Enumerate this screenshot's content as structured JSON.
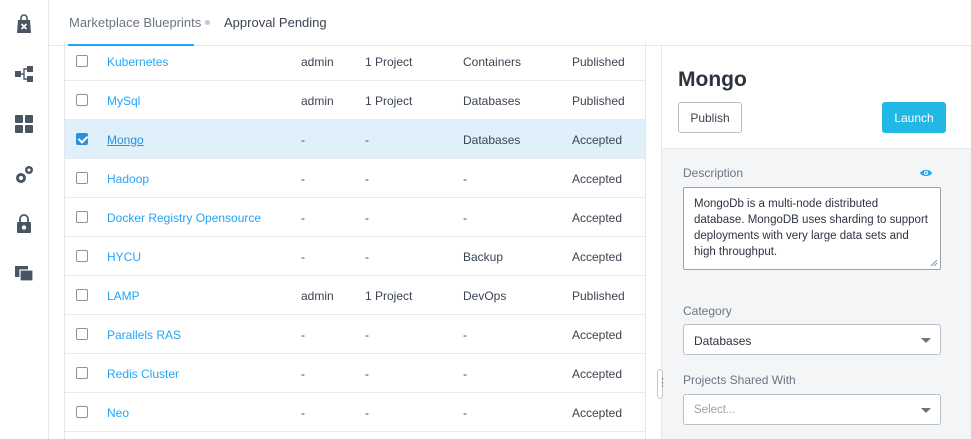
{
  "header": {
    "breadcrumb_1": "Marketplace Blueprints",
    "breadcrumb_2": "Approval Pending"
  },
  "rail": {
    "items": [
      "bag-x-icon",
      "nodes-icon",
      "apps-grid-icon",
      "gears-icon",
      "lock-gear-icon",
      "folders-icon"
    ]
  },
  "table": {
    "rows": [
      {
        "name": "Kubernetes",
        "owner": "admin",
        "projects": "1 Project",
        "category": "Containers",
        "status": "Published",
        "checked": false
      },
      {
        "name": "MySql",
        "owner": "admin",
        "projects": "1 Project",
        "category": "Databases",
        "status": "Published",
        "checked": false
      },
      {
        "name": "Mongo",
        "owner": "-",
        "projects": "-",
        "category": "Databases",
        "status": "Accepted",
        "checked": true
      },
      {
        "name": "Hadoop",
        "owner": "-",
        "projects": "-",
        "category": "-",
        "status": "Accepted",
        "checked": false
      },
      {
        "name": "Docker Registry Opensource",
        "owner": "-",
        "projects": "-",
        "category": "-",
        "status": "Accepted",
        "checked": false
      },
      {
        "name": "HYCU",
        "owner": "-",
        "projects": "-",
        "category": "Backup",
        "status": "Accepted",
        "checked": false
      },
      {
        "name": "LAMP",
        "owner": "admin",
        "projects": "1 Project",
        "category": "DevOps",
        "status": "Published",
        "checked": false
      },
      {
        "name": "Parallels RAS",
        "owner": "-",
        "projects": "-",
        "category": "-",
        "status": "Accepted",
        "checked": false
      },
      {
        "name": "Redis Cluster",
        "owner": "-",
        "projects": "-",
        "category": "-",
        "status": "Accepted",
        "checked": false
      },
      {
        "name": "Neo",
        "owner": "-",
        "projects": "-",
        "category": "-",
        "status": "Accepted",
        "checked": false
      }
    ]
  },
  "detail": {
    "title": "Mongo",
    "publish_label": "Publish",
    "launch_label": "Launch",
    "description_label": "Description",
    "description": "MongoDb is a multi-node distributed database. MongoDB uses sharding to support deployments with very large data sets and high throughput.",
    "category_label": "Category",
    "category_value": "Databases",
    "projects_label": "Projects Shared With",
    "projects_placeholder": "Select..."
  },
  "colors": {
    "accent": "#22a5f7",
    "launch": "#22b8e6",
    "selected_row": "#dff0fb"
  }
}
